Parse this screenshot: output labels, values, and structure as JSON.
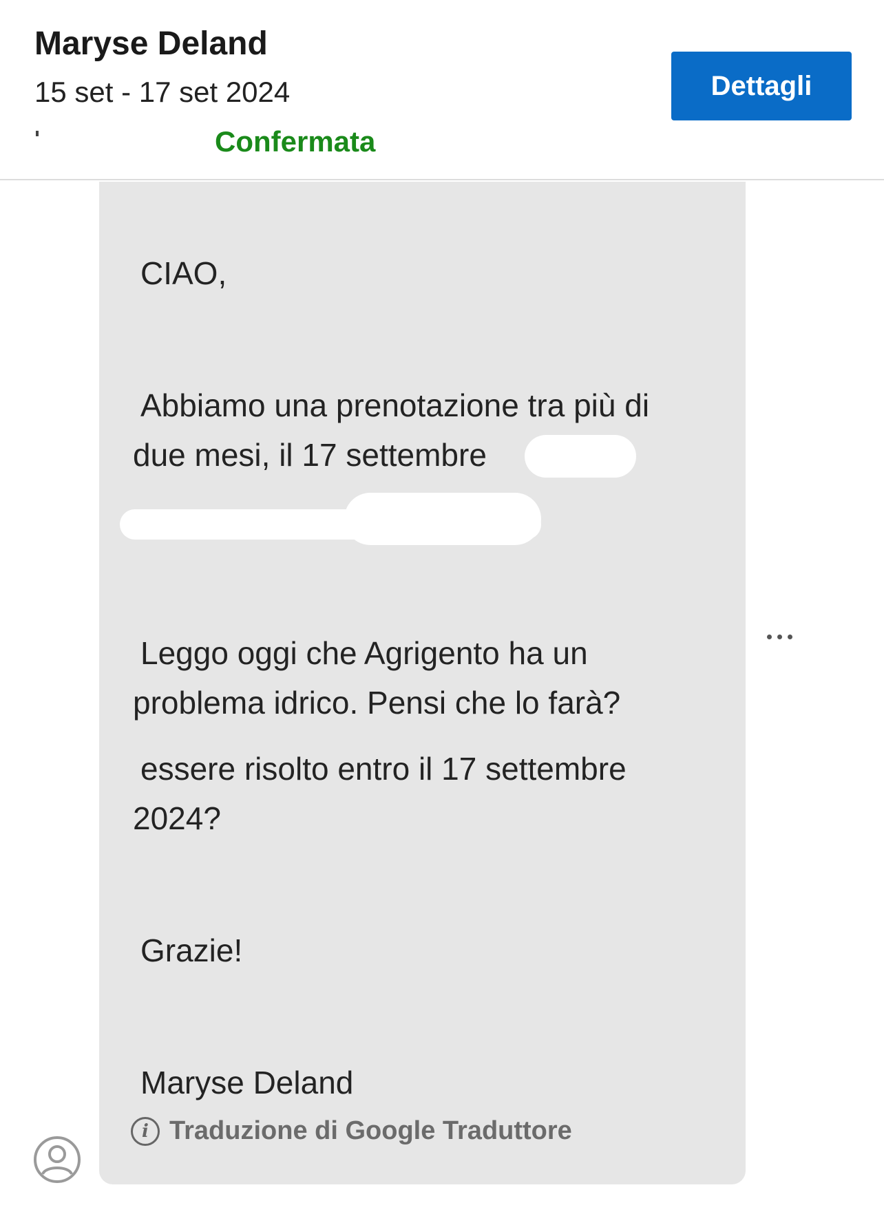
{
  "header": {
    "guest_name": "Maryse Deland",
    "dates": "15 set - 17 set 2024",
    "status": "Confermata",
    "status_color": "#1a8a1a",
    "details_button": "Dettagli",
    "accent_color": "#0a6cc7"
  },
  "message": {
    "greeting": "CIAO,",
    "line1": "Abbiamo una prenotazione tra più di",
    "line2": "due mesi, il 17 settembre",
    "line3": "Leggo oggi che Agrigento ha un",
    "line4": "problema idrico. Pensi che lo farà?",
    "line5": "essere risolto entro il 17 settembre",
    "line6": "2024?",
    "thanks": "Grazie!",
    "signature": "Maryse Deland",
    "translation_note": "Traduzione di Google Traduttore",
    "info_icon": "info-icon"
  },
  "actions": {
    "more_icon": "more-horizontal-icon"
  },
  "sender": {
    "avatar_icon": "user-avatar-icon"
  }
}
